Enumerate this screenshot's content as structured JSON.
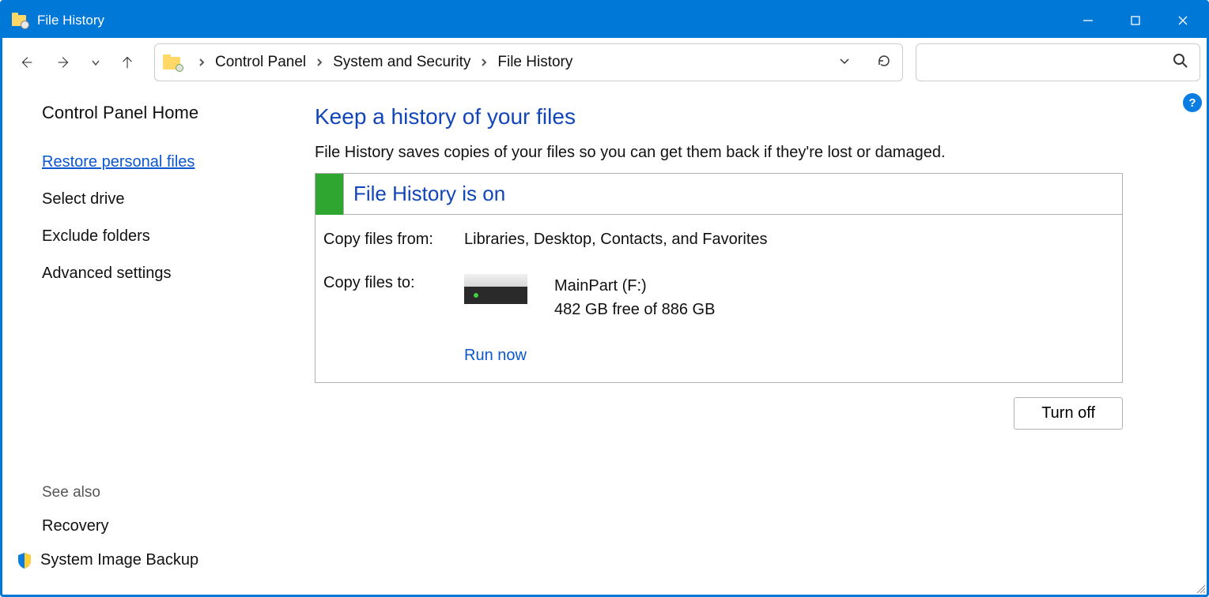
{
  "titlebar": {
    "title": "File History"
  },
  "breadcrumb": {
    "items": [
      "Control Panel",
      "System and Security",
      "File History"
    ]
  },
  "sidebar": {
    "home": "Control Panel Home",
    "links": [
      {
        "label": "Restore personal files",
        "active": true
      },
      {
        "label": "Select drive",
        "active": false
      },
      {
        "label": "Exclude folders",
        "active": false
      },
      {
        "label": "Advanced settings",
        "active": false
      }
    ],
    "see_also_hdr": "See also",
    "see_also": [
      "Recovery",
      "System Image Backup"
    ]
  },
  "main": {
    "heading": "Keep a history of your files",
    "description": "File History saves copies of your files so you can get them back if they're lost or damaged.",
    "status_text": "File History is on",
    "copy_from_label": "Copy files from:",
    "copy_from_value": "Libraries, Desktop, Contacts, and Favorites",
    "copy_to_label": "Copy files to:",
    "drive_name": "MainPart (F:)",
    "drive_space": "482 GB free of 886 GB",
    "run_now": "Run now",
    "turn_off": "Turn off"
  }
}
